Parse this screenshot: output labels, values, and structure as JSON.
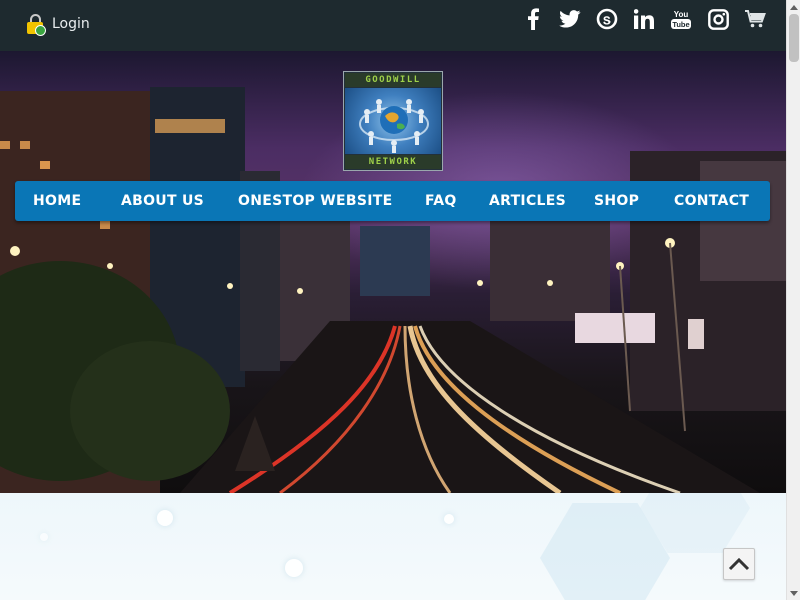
{
  "header": {
    "login_label": "Login"
  },
  "social_icons": [
    "facebook-icon",
    "twitter-icon",
    "skype-icon",
    "linkedin-icon",
    "youtube-icon",
    "instagram-icon",
    "cart-icon"
  ],
  "logo": {
    "top_text": "GOODWILL",
    "bottom_text": "NETWORK"
  },
  "nav": {
    "items": [
      {
        "label": "HOME"
      },
      {
        "label": "ABOUT US"
      },
      {
        "label": "ONESTOP WEBSITE"
      },
      {
        "label": "FAQ"
      },
      {
        "label": "ARTICLES"
      },
      {
        "label": "SHOP"
      },
      {
        "label": "CONTACT"
      }
    ]
  },
  "colors": {
    "nav_bg": "#0a76b6",
    "topbar_bg": "#1e2a2f",
    "logo_text": "#9fd14a"
  }
}
